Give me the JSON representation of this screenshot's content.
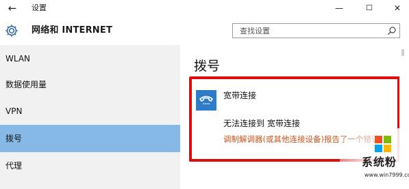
{
  "window": {
    "back_icon": "arrow-left-icon",
    "title": "设置",
    "minimize_glyph": "—",
    "maximize_glyph": "☐",
    "close_glyph": "✕"
  },
  "header": {
    "icon": "gear-icon",
    "title": "网络和 INTERNET"
  },
  "search": {
    "placeholder": "查找设置",
    "icon": "search-icon"
  },
  "sidebar": {
    "items": [
      {
        "label": "WLAN",
        "active": false
      },
      {
        "label": "数据使用量",
        "active": false
      },
      {
        "label": "VPN",
        "active": false
      },
      {
        "label": "拨号",
        "active": true
      },
      {
        "label": "代理",
        "active": false
      }
    ]
  },
  "main": {
    "title": "拨号",
    "connection": {
      "icon": "phone-icon",
      "name": "宽带连接",
      "status": "无法连接到 宽带连接",
      "error": "调制解调器(或其他连接设备)报告了一个错误。"
    }
  },
  "watermark": {
    "text": "系统粉",
    "url": "www.win7999.com"
  },
  "colors": {
    "active_sidebar": "#87b9e6",
    "highlight_border": "#e00b0b",
    "error_text": "#c8531b",
    "icon_blue": "#2e7cc8"
  }
}
